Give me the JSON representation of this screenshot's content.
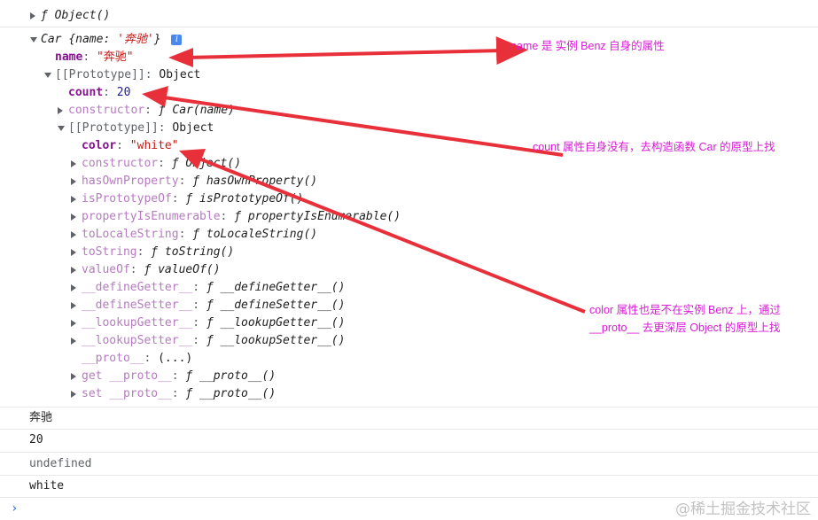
{
  "rows": {
    "object_fn": "ƒ Object()",
    "car_header_name": "Car",
    "car_header_preview_open": "{name: ",
    "car_header_preview_value": "'奔驰'",
    "car_header_preview_close": "}",
    "info_badge": "i",
    "name_key": "name",
    "name_value": "\"奔驰\"",
    "proto1_label": "[[Prototype]]",
    "proto1_value": "Object",
    "count_key": "count",
    "count_value": "20",
    "constructor1_key": "constructor",
    "constructor1_value": "ƒ Car(name)",
    "proto2_label": "[[Prototype]]",
    "proto2_value": "Object",
    "color_key": "color",
    "color_value": "\"white\"",
    "constructor2_key": "constructor",
    "constructor2_value": "ƒ Object()",
    "hasown_key": "hasOwnProperty",
    "hasown_value": "ƒ hasOwnProperty()",
    "isproto_key": "isPrototypeOf",
    "isproto_value": "ƒ isPrototypeOf()",
    "propenum_key": "propertyIsEnumerable",
    "propenum_value": "ƒ propertyIsEnumerable()",
    "tolocale_key": "toLocaleString",
    "tolocale_value": "ƒ toLocaleString()",
    "tostring_key": "toString",
    "tostring_value": "ƒ toString()",
    "valueof_key": "valueOf",
    "valueof_value": "ƒ valueOf()",
    "defget_key": "__defineGetter__",
    "defget_value": "ƒ __defineGetter__()",
    "defset_key": "__defineSetter__",
    "defset_value": "ƒ __defineSetter__()",
    "lookget_key": "__lookupGetter__",
    "lookget_value": "ƒ __lookupGetter__()",
    "lookset_key": "__lookupSetter__",
    "lookset_value": "ƒ __lookupSetter__()",
    "proto_key": "__proto__",
    "proto_value": "(...)",
    "getproto_key": "get __proto__",
    "getproto_value": "ƒ __proto__()",
    "setproto_key": "set __proto__",
    "setproto_value": "ƒ __proto__()"
  },
  "outputs": {
    "line1": "奔驰",
    "line2": "20",
    "line3": "undefined",
    "line4": "white"
  },
  "prompt_glyph": "›",
  "annotations": {
    "name_note": "name 是 实例 Benz 自身的属性",
    "count_note": "count 属性自身没有，去构造函数 Car 的原型上找",
    "color_note_line1": "color 属性也是不在实例 Benz 上，通过",
    "color_note_line2": "__proto__ 去更深层 Object 的原型上找"
  },
  "watermark": "@稀土掘金技术社区",
  "colors": {
    "annotation": "#d81bd6",
    "arrow": "#e8303a",
    "key": "#881391",
    "string": "#c41a16",
    "number": "#1a1aa6"
  }
}
